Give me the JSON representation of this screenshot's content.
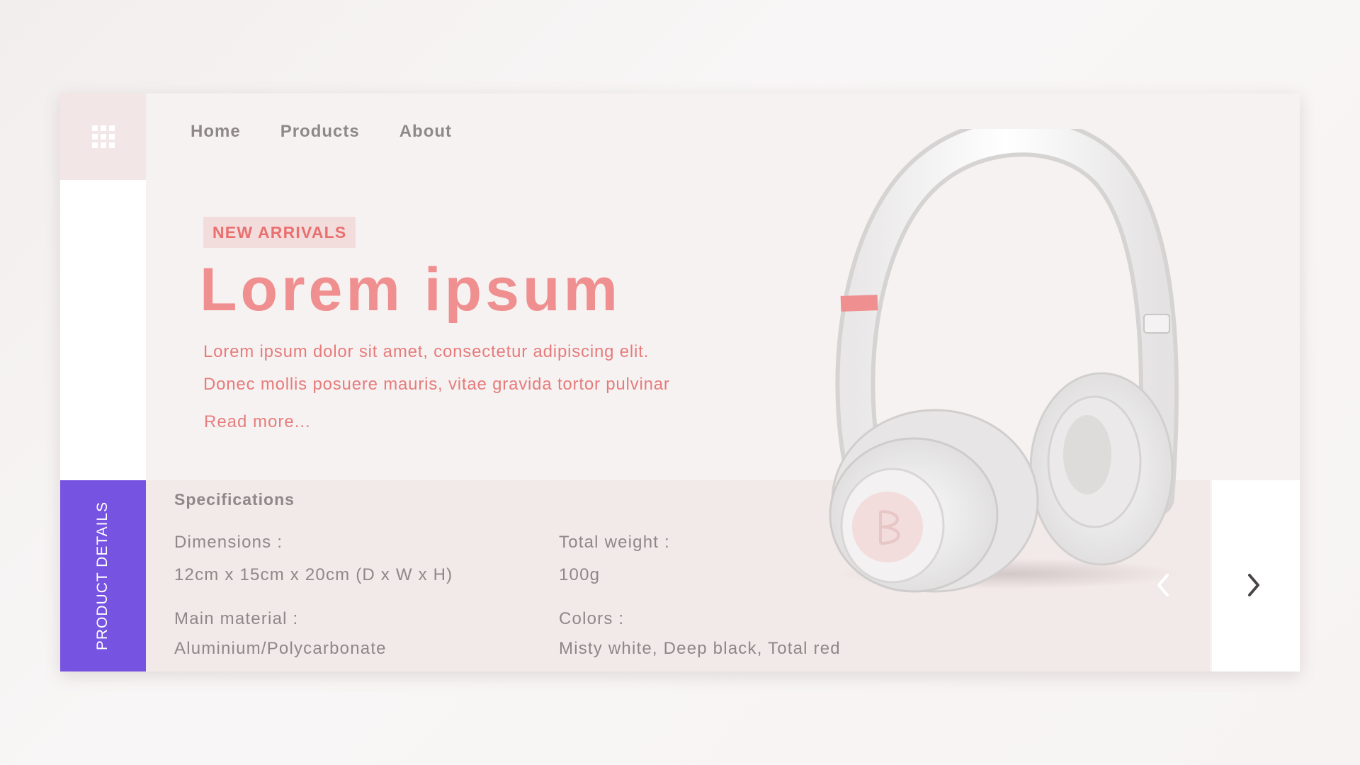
{
  "nav": {
    "items": [
      {
        "label": "Home"
      },
      {
        "label": "Products"
      },
      {
        "label": "About"
      }
    ]
  },
  "hero": {
    "badge": "NEW ARRIVALS",
    "title": "Lorem ipsum",
    "description_line1": "Lorem ipsum dolor sit amet, consectetur adipiscing elit.",
    "description_line2": "Donec mollis posuere mauris, vitae gravida tortor pulvinar",
    "read_more": "Read more..."
  },
  "side_tab": {
    "label": "PRODUCT DETAILS"
  },
  "specs": {
    "title": "Specifications",
    "dimensions_label": "Dimensions :",
    "dimensions_value": "12cm x 15cm x 20cm (D x W x H)",
    "weight_label": "Total weight :",
    "weight_value": "100g",
    "material_label": "Main material :",
    "material_value": "Aluminium/Polycarbonate",
    "colors_label": "Colors :",
    "colors_value": "Misty white, Deep black, Total red"
  },
  "colors": {
    "accent_purple": "#7653e0",
    "accent_pink": "#ef8f8f",
    "badge_bg": "#f2dcdc"
  },
  "icons": {
    "menu": "grid-menu-icon",
    "prev": "chevron-left-icon",
    "next": "chevron-right-icon",
    "product": "headphones-image"
  }
}
